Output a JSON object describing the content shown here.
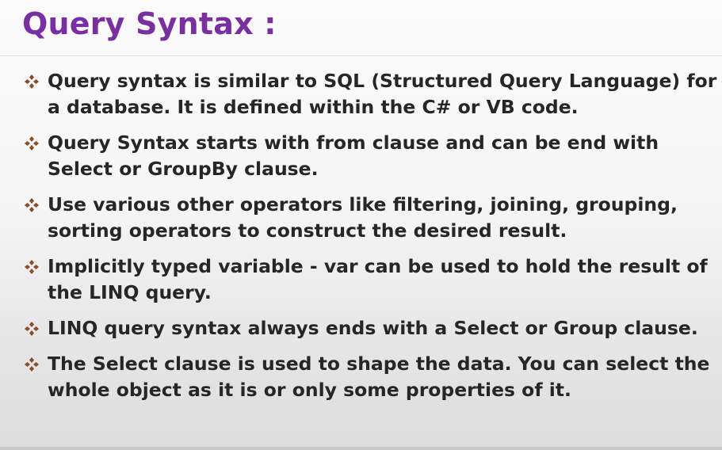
{
  "slide": {
    "title": "Query Syntax :",
    "bullet_icon": "diamond-cluster-icon",
    "accent_color": "#7a2fa0",
    "bullet_color": "#8b4a2a",
    "bullets": [
      "Query syntax is similar to SQL (Structured Query Language) for a database. It is defined within the C# or VB code.",
      "Query Syntax starts with from clause and can be end with Select or GroupBy clause.",
      "Use various other operators like filtering, joining, grouping, sorting operators to construct the desired result.",
      "Implicitly typed variable - var can be used to hold the result of the LINQ query.",
      "LINQ query syntax always ends with a Select or Group clause.",
      "The Select clause is used to shape the data. You can select the whole object as it is or only some properties of it."
    ]
  }
}
